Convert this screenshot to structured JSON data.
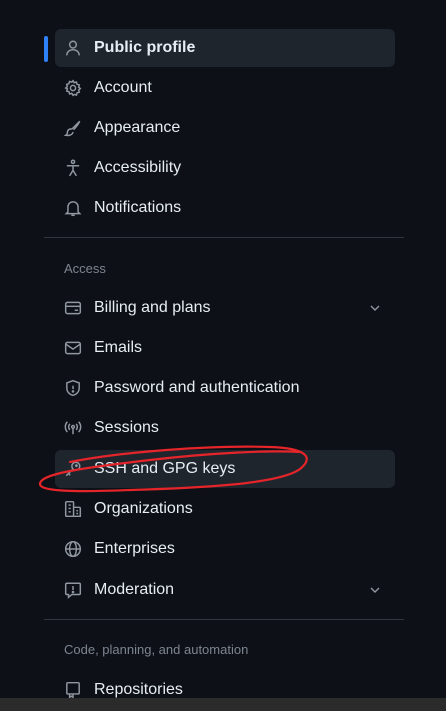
{
  "top_items": [
    {
      "label": "Public profile",
      "icon": "person-icon"
    },
    {
      "label": "Account",
      "icon": "gear-icon"
    },
    {
      "label": "Appearance",
      "icon": "paintbrush-icon"
    },
    {
      "label": "Accessibility",
      "icon": "accessibility-icon"
    },
    {
      "label": "Notifications",
      "icon": "bell-icon"
    }
  ],
  "access": {
    "heading": "Access",
    "items": [
      {
        "label": "Billing and plans",
        "icon": "credit-card-icon"
      },
      {
        "label": "Emails",
        "icon": "mail-icon"
      },
      {
        "label": "Password and authentication",
        "icon": "shield-icon"
      },
      {
        "label": "Sessions",
        "icon": "broadcast-icon"
      },
      {
        "label": "SSH and GPG keys",
        "icon": "key-icon"
      },
      {
        "label": "Organizations",
        "icon": "organization-icon"
      },
      {
        "label": "Enterprises",
        "icon": "globe-icon"
      },
      {
        "label": "Moderation",
        "icon": "report-icon"
      }
    ]
  },
  "code": {
    "heading": "Code, planning, and automation",
    "items": [
      {
        "label": "Repositories",
        "icon": "repo-icon"
      }
    ]
  },
  "colors": {
    "background": "#0d1117",
    "active_bar": "#2f81f7",
    "annotation": "#e5252a"
  }
}
